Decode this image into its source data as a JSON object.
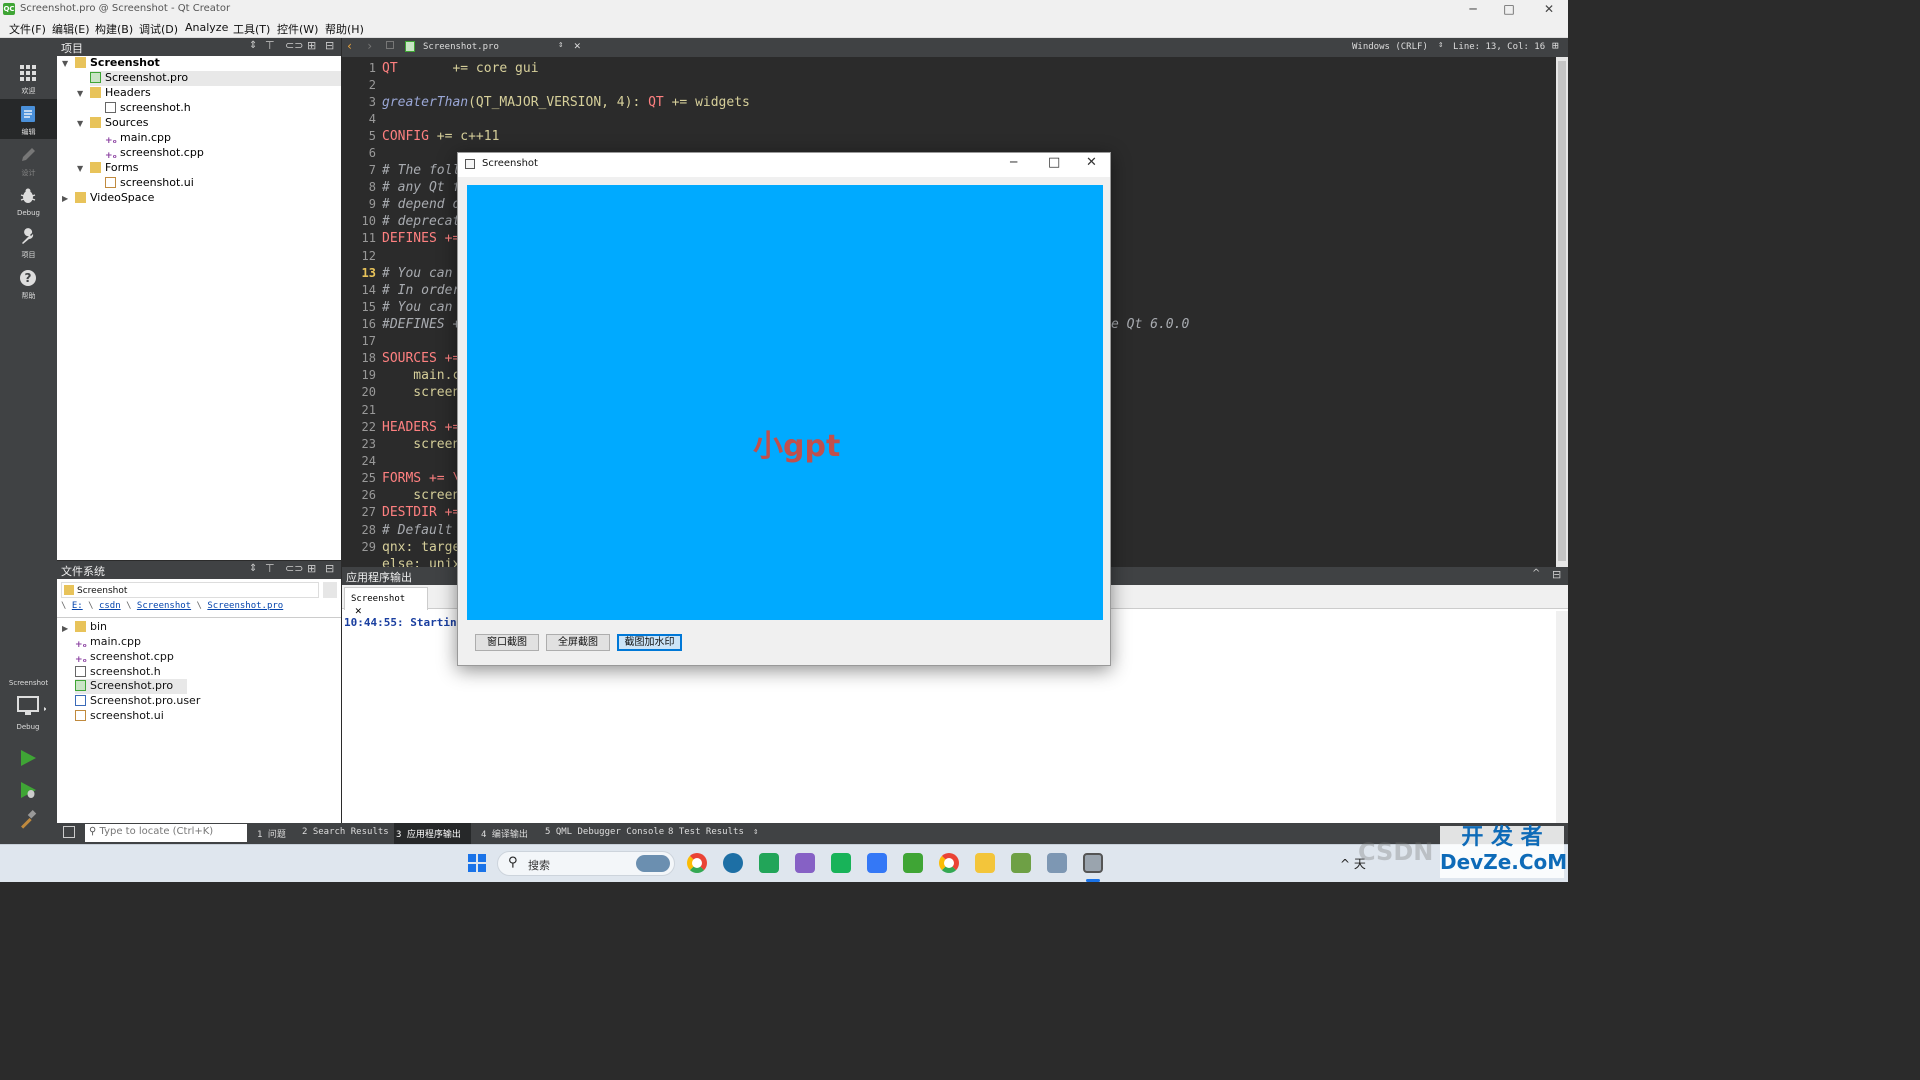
{
  "window": {
    "title": "Screenshot.pro @ Screenshot - Qt Creator",
    "app_icon": "QC",
    "controls": [
      "─",
      "□",
      "✕"
    ]
  },
  "menu": [
    "文件(F)",
    "编辑(E)",
    "构建(B)",
    "调试(D)",
    "Analyze",
    "工具(T)",
    "控件(W)",
    "帮助(H)"
  ],
  "modes": [
    {
      "label": "欢迎",
      "icon": "grid-icon"
    },
    {
      "label": "编辑",
      "icon": "edit-doc-icon"
    },
    {
      "label": "设计",
      "icon": "pencil-icon"
    },
    {
      "label": "Debug",
      "icon": "bug-icon"
    },
    {
      "label": "项目",
      "icon": "wrench-icon"
    },
    {
      "label": "帮助",
      "icon": "help-icon"
    }
  ],
  "kit": {
    "project": "Screenshot",
    "config": "Debug"
  },
  "projects_panel": {
    "title": "项目",
    "items": [
      {
        "label": "Screenshot",
        "bold": true
      },
      {
        "label": "Screenshot.pro"
      },
      {
        "label": "Headers"
      },
      {
        "label": "screenshot.h"
      },
      {
        "label": "Sources"
      },
      {
        "label": "main.cpp"
      },
      {
        "label": "screenshot.cpp"
      },
      {
        "label": "Forms"
      },
      {
        "label": "screenshot.ui"
      },
      {
        "label": "VideoSpace"
      }
    ]
  },
  "fs_panel": {
    "title": "文件系统",
    "combo": "Screenshot",
    "crumbs": [
      "E:",
      "csdn",
      "Screenshot",
      "Screenshot.pro"
    ],
    "items": [
      "bin",
      "main.cpp",
      "screenshot.cpp",
      "screenshot.h",
      "Screenshot.pro",
      "Screenshot.pro.user",
      "screenshot.ui"
    ]
  },
  "editor": {
    "filename": "Screenshot.pro",
    "line_ending": "Windows (CRLF)",
    "position": "Line: 13, Col: 16",
    "lines": [
      "1",
      "2",
      "3",
      "4",
      "5",
      "6",
      "7",
      "8",
      "9",
      "10",
      "11",
      "12",
      "13",
      "14",
      "15",
      "16",
      "17",
      "18",
      "19",
      "20",
      "21",
      "22",
      "23",
      "24",
      "25",
      "26",
      "27",
      "28",
      "29"
    ],
    "code": {
      "l1a": "QT",
      "l1b": "       += core gui",
      "l3a": "greaterThan",
      "l3b": "(QT_MAJOR_VERSION, 4): ",
      "l3c": "QT",
      "l3d": " += widgets",
      "l5a": "CONFIG",
      "l5b": " += c++11",
      "l7": "# The foll",
      "l8": "# any Qt f",
      "l9": "# depend o",
      "l10": "# deprecat",
      "l11": "DEFINES +=",
      "l13": "# You can",
      "l14": "# In order",
      "l15": "# You can",
      "l16a": "#DEFINES +",
      "l16b": "e Qt 6.0.0",
      "l18": "SOURCES +=",
      "l19": "    main.c",
      "l20": "    screen",
      "l22": "HEADERS +=",
      "l23": "    screen",
      "l25": "FORMS += \\",
      "l26": "    screen",
      "l27": "DESTDIR +=",
      "l28": "# Default",
      "l29": "qnx: targe",
      "l30": "else: unix"
    }
  },
  "output_panel": {
    "title": "应用程序输出",
    "tab": "Screenshot",
    "log": "10:44:55: Starting"
  },
  "status_tabs": [
    "1 问题",
    "2 Search Results",
    "3 应用程序输出",
    "4 编译输出",
    "5 QML Debugger Console",
    "8 Test Results"
  ],
  "locator_placeholder": "Type to locate (Ctrl+K)",
  "dialog": {
    "title": "Screenshot",
    "canvas_color": "#00aaff",
    "watermark": "小gpt",
    "buttons": [
      "窗口截图",
      "全屏截图",
      "截图加水印"
    ]
  },
  "taskbar": {
    "search_label": "搜索",
    "tray_text": "^ 天"
  },
  "corner_watermark": {
    "line1": "开 发 者",
    "line2": "DevZe.CoM",
    "faint": "CSDN"
  }
}
